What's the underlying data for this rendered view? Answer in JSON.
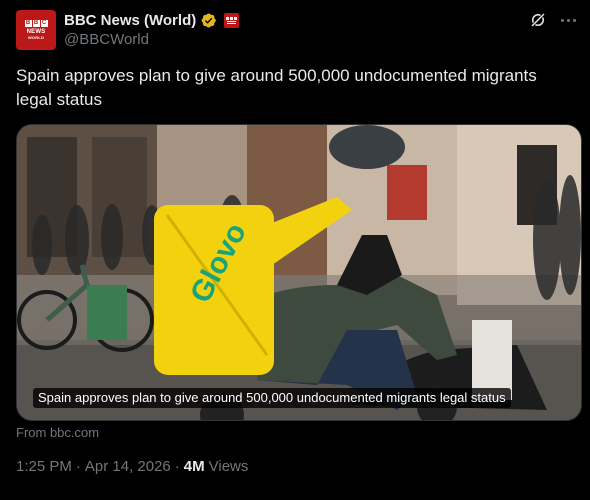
{
  "author": {
    "display_name": "BBC News (World)",
    "handle": "@BBCWorld",
    "avatar_lines": [
      "NEWS",
      "WORLD"
    ],
    "verified_color": "#e2b719",
    "brand_color": "#bb1919"
  },
  "avatar_letters": [
    "B",
    "B",
    "C"
  ],
  "icons": {
    "verified": "verified-badge-icon",
    "affiliation": "affiliate-bbc-icon",
    "grok": "grok-icon",
    "more": "more-icon"
  },
  "tweet": {
    "text": "Spain approves plan to give around 500,000 undocumented migrants legal status"
  },
  "media": {
    "caption": "Spain approves plan to give around 500,000 undocumented migrants legal status",
    "description_icon": "photo",
    "bag_brand": "Glovo"
  },
  "card_source": "From bbc.com",
  "meta": {
    "time": "1:25 PM",
    "separator": "·",
    "date": "Apr 14, 2026",
    "views_count": "4M",
    "views_label": "Views"
  }
}
